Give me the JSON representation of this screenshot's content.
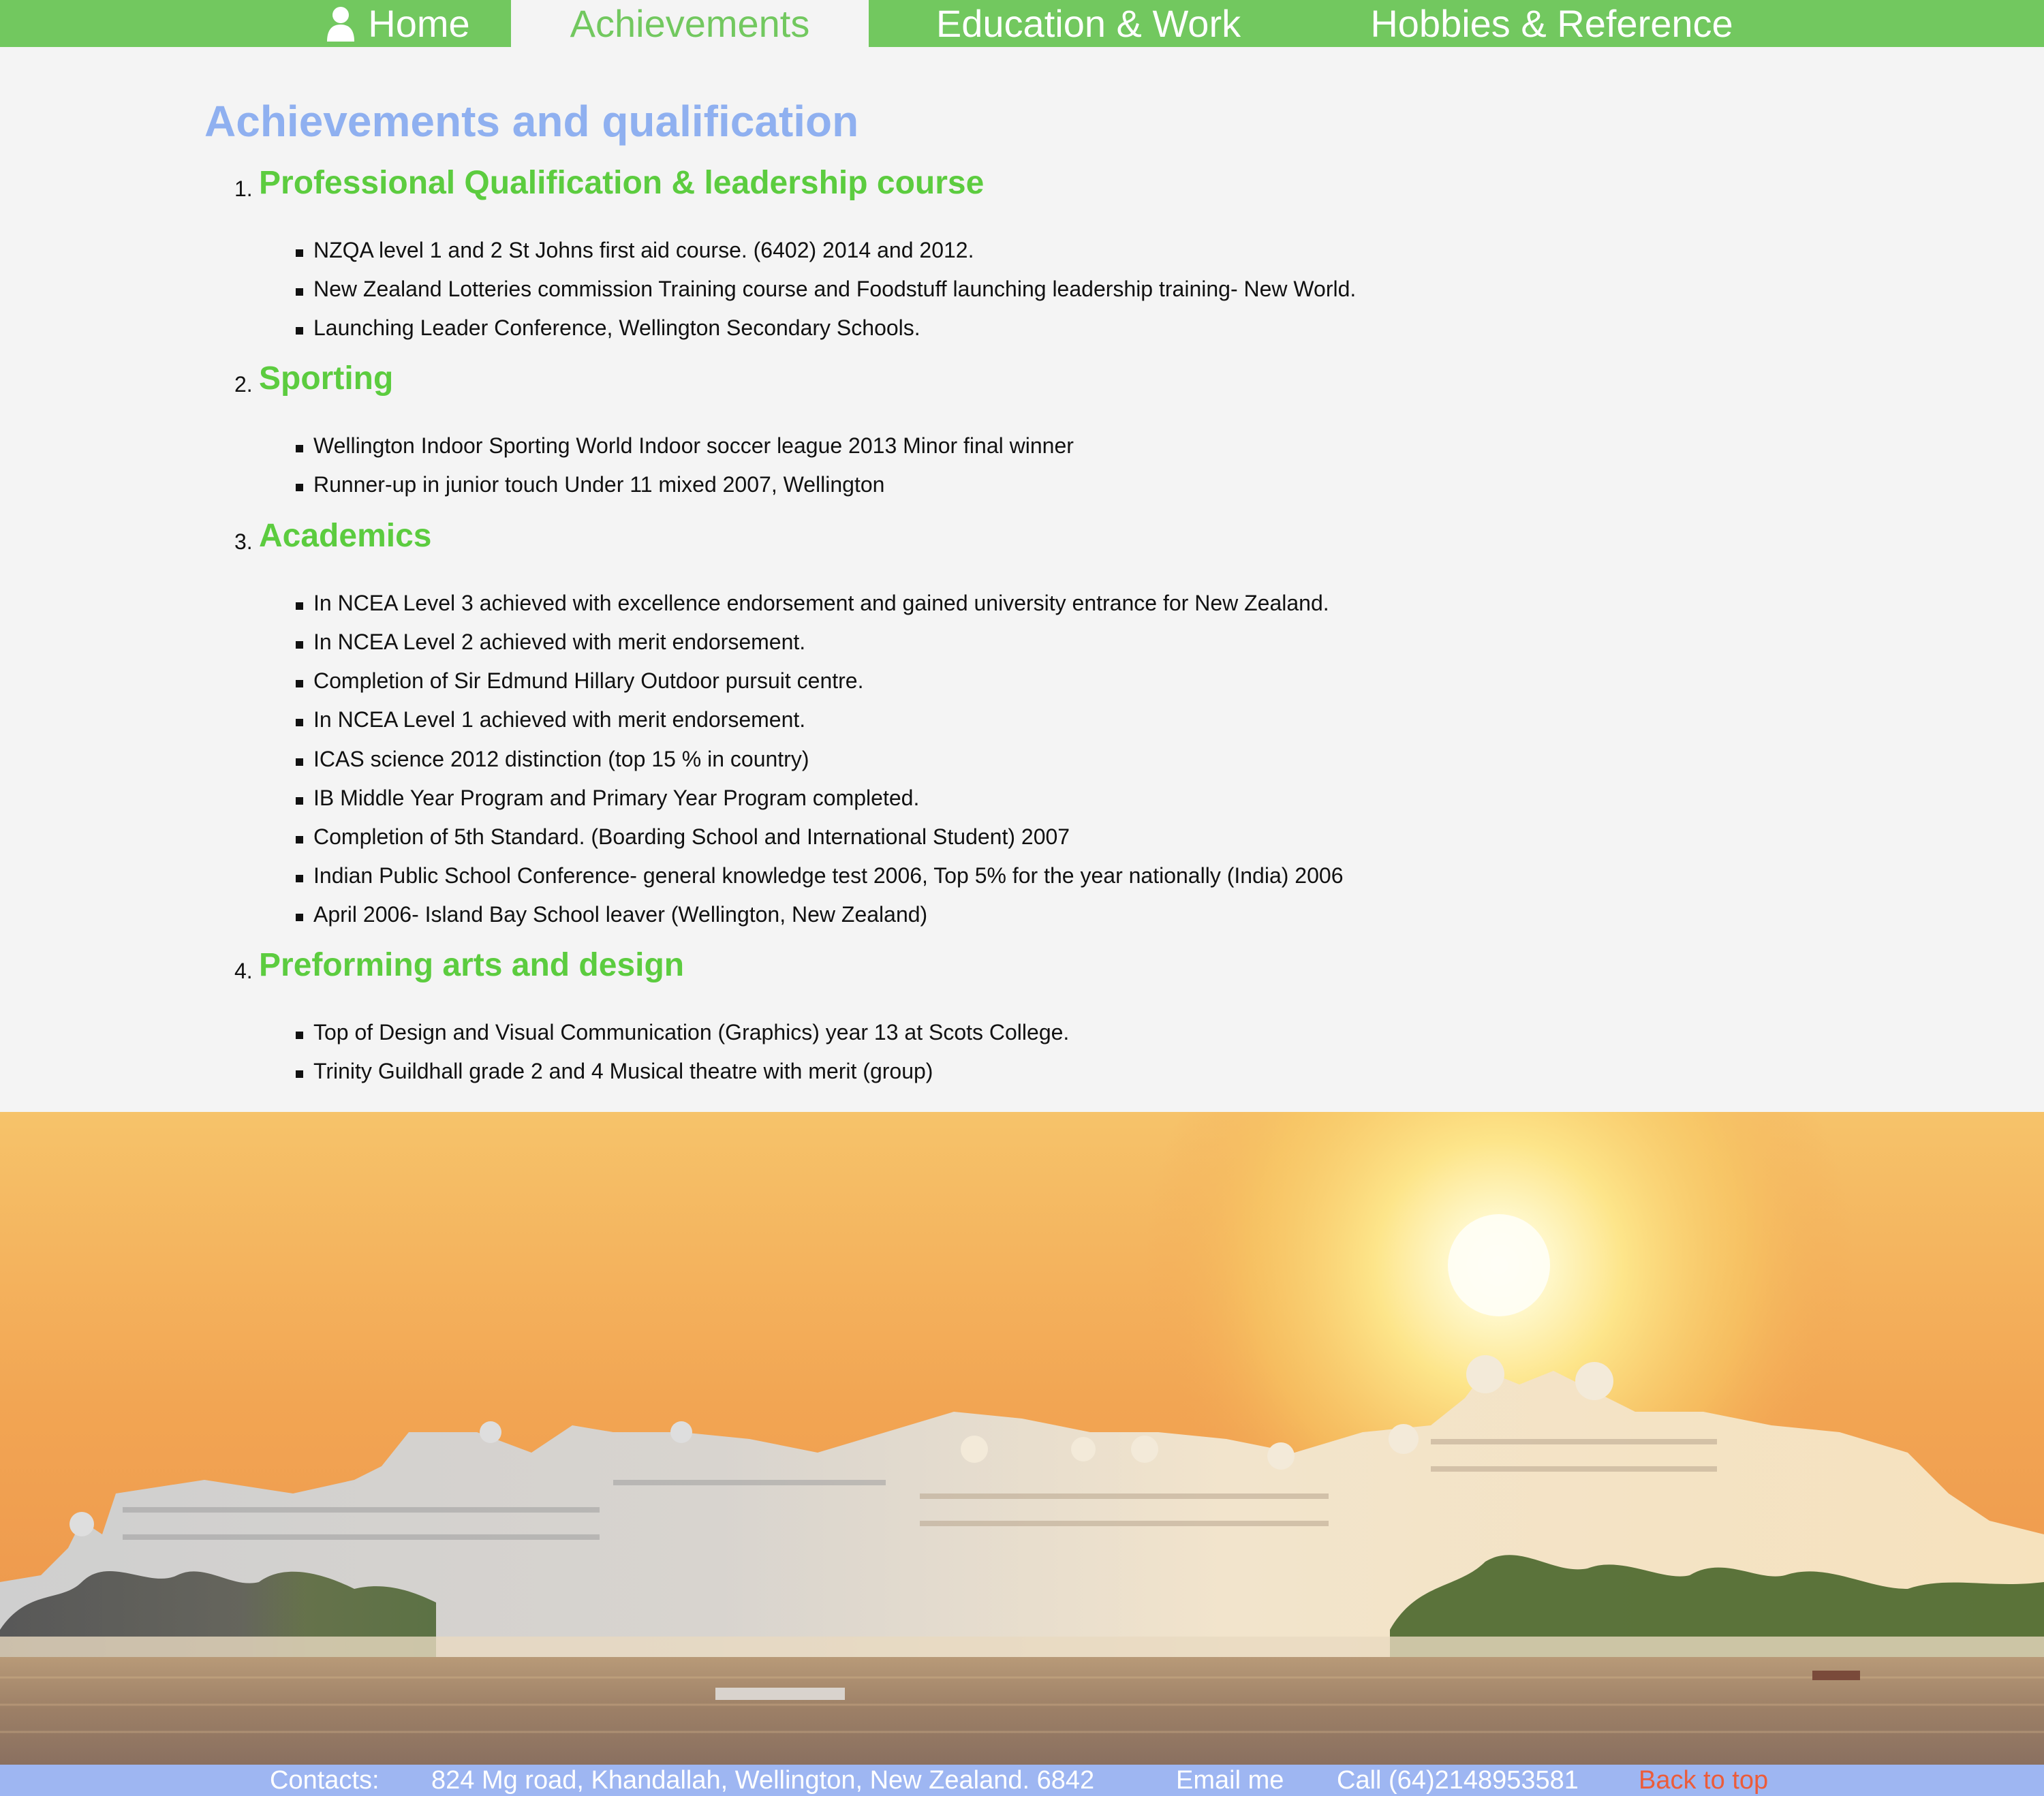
{
  "nav": {
    "home": "Home",
    "achievements": "Achievements",
    "education": "Education & Work",
    "hobbies": "Hobbies & Reference"
  },
  "page_title": "Achievements and qualification",
  "sections": [
    {
      "num": "1.",
      "title": "Professional Qualification & leadership course",
      "items": [
        "NZQA level 1 and 2 St Johns first aid course. (6402) 2014 and 2012.",
        "New Zealand Lotteries commission Training course and Foodstuff launching leadership training- New World.",
        "Launching Leader Conference, Wellington Secondary Schools."
      ]
    },
    {
      "num": "2.",
      "title": "Sporting",
      "items": [
        "Wellington Indoor Sporting World Indoor soccer league 2013 Minor final winner",
        "Runner-up in junior touch Under 11 mixed 2007, Wellington"
      ]
    },
    {
      "num": "3.",
      "title": "Academics",
      "items": [
        "In NCEA Level 3 achieved with excellence endorsement and gained university entrance for New Zealand.",
        "In NCEA Level 2 achieved with merit endorsement.",
        "Completion of Sir Edmund Hillary Outdoor pursuit centre.",
        "In NCEA Level 1 achieved with merit endorsement.",
        "ICAS science 2012 distinction (top 15 % in country)",
        "IB Middle Year Program and Primary Year Program completed.",
        "Completion of 5th Standard. (Boarding School and International Student) 2007",
        "Indian Public School Conference- general knowledge test 2006, Top 5% for the year nationally (India) 2006",
        "April 2006- Island Bay School leaver (Wellington, New Zealand)"
      ]
    },
    {
      "num": "4.",
      "title": "Preforming arts and design",
      "items": [
        "Top of Design and Visual Communication (Graphics) year 13 at Scots College.",
        "Trinity Guildhall grade 2 and 4 Musical theatre with merit (group)"
      ]
    }
  ],
  "footer": {
    "contacts_label": "Contacts:",
    "address": "824 Mg road, Khandallah, Wellington, New Zealand. 6842",
    "email": "Email me",
    "call": "Call (64)2148953581",
    "back_to_top": "Back to top"
  },
  "colors": {
    "nav_green": "#72c85f",
    "title_blue": "#8fb0f0",
    "section_green": "#5ccc3f",
    "footer_blue": "#9eb6f2",
    "back_to_top": "#ec5c3a"
  },
  "icons": {
    "home": "user-icon"
  }
}
